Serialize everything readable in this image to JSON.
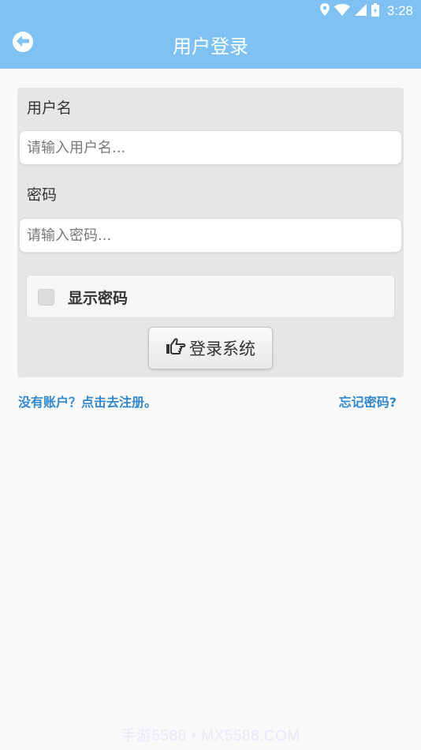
{
  "status_bar": {
    "time": "3:28",
    "icons": [
      "location-icon",
      "wifi-icon",
      "signal-icon",
      "battery-icon"
    ]
  },
  "header": {
    "title": "用户登录",
    "back_icon": "arrow-left-icon"
  },
  "form": {
    "username_label": "用户名",
    "username_value": "",
    "username_placeholder": "请输入用户名...",
    "password_label": "密码",
    "password_value": "",
    "password_placeholder": "请输入密码...",
    "show_password_label": "显示密码",
    "show_password_checked": false,
    "login_button_label": "登录系统",
    "login_button_icon": "hand-pointing-icon"
  },
  "links": {
    "register": "没有账户？点击去注册。",
    "forgot_password": "忘记密码?"
  },
  "watermark": "手游5588 • MX5588.COM",
  "colors": {
    "header_bg": "#7ec1f2",
    "link": "#3388cc",
    "card_bg": "#e6e6e6",
    "page_bg": "#f9f9f9"
  }
}
